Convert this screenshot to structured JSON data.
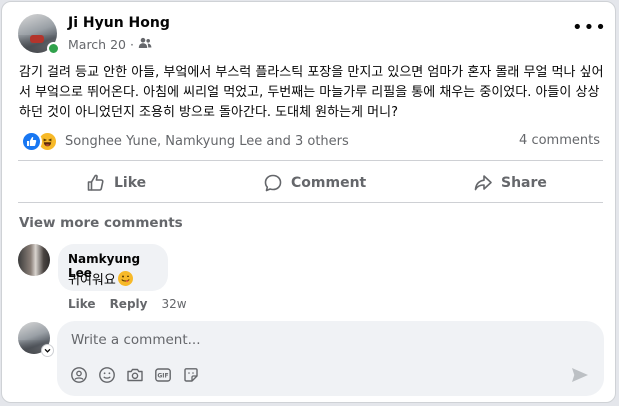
{
  "post": {
    "author": "Ji Hyun Hong",
    "date": "March 20",
    "dot": "·",
    "audience_icon": "friends-icon",
    "more_label": "•••",
    "text": "감기 걸려 등교 안한 아들, 부엌에서 부스럭 플라스틱 포장을 만지고 있으면 엄마가 혼자 몰래 무얼 먹나 싶어서 부엌으로 뛰어온다. 아침에 씨리얼 먹었고, 두번째는 마늘가루 리필을 통에 채우는 중이었다. 아들이 상상하던 것이 아니었던지 조용히 방으로 돌아간다. 도대체 원하는게 머니?"
  },
  "reactions": {
    "icons": [
      "like-reaction-icon",
      "haha-reaction-icon"
    ],
    "summary": "Songhee Yune, Namkyung Lee and 3 others",
    "comments_count": "4 comments"
  },
  "actions": {
    "like": "Like",
    "comment": "Comment",
    "share": "Share"
  },
  "comments": {
    "view_more": "View more comments",
    "items": [
      {
        "author": "Namkyung Lee",
        "text": "귀여워요",
        "emoji": "winking-face-tongue-emoji",
        "like": "Like",
        "reply": "Reply",
        "time": "32w"
      }
    ]
  },
  "composer": {
    "placeholder": "Write a comment...",
    "tools": [
      "avatar-sticker-icon",
      "emoji-icon",
      "camera-icon",
      "gif-icon",
      "sticker-icon"
    ],
    "send_icon": "send-icon"
  },
  "colors": {
    "like_blue": "#1877f2",
    "online_green": "#31a24c",
    "text_secondary": "#65676b",
    "bubble_bg": "#f0f2f5"
  }
}
